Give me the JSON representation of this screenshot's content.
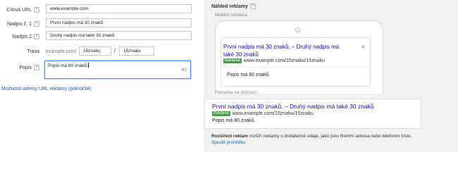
{
  "form": {
    "final_url": {
      "label": "Cílová URL",
      "value": "www.example.com"
    },
    "headline1": {
      "label": "Nadpis č. 1",
      "value": "První nadpis má 30 znaků"
    },
    "headline2": {
      "label": "Nadpis 2",
      "value": "Druhý nadpis má také 30 znaků"
    },
    "path": {
      "label": "Trasa",
      "domain": "example.com",
      "slash": "/",
      "path1": "15znaku",
      "path2": "15znaku"
    },
    "description": {
      "label": "Popis",
      "value": "Popis má 80 znaků.",
      "counter": "62"
    },
    "help_glyph": "?",
    "advanced_link": "Možnosti adresy URL reklamy (pokročilé)"
  },
  "preview": {
    "title": "Náhled reklamy",
    "mobile_label": "Mobilní reklama",
    "desktop_label": "Reklama na počítači",
    "ad": {
      "headline_mobile_line1": "První nadpis má 30 znaků. – Druhý nadpis má",
      "headline_mobile_line2": "také 30 znaků",
      "headline_desktop": "První nadpis má 30 znaků. – Druhý nadpis má také 30 znaků",
      "badge": "Reklama",
      "url": "www.example.com/15znaku/15znaku",
      "description": "Popis má 80 znaků."
    },
    "extensions": {
      "bold": "Rozšíření reklam",
      "text": " rozšíří reklamy o dodatečné údaje, jako jsou firemní adresa nebo telefonní číslo. ",
      "link": "Spustit prohlídku"
    }
  },
  "colors": {
    "ad_title": "#1a0dab",
    "badge": "#4a9b4a",
    "link": "#1a5fb4",
    "focus": "#4d90fe"
  }
}
